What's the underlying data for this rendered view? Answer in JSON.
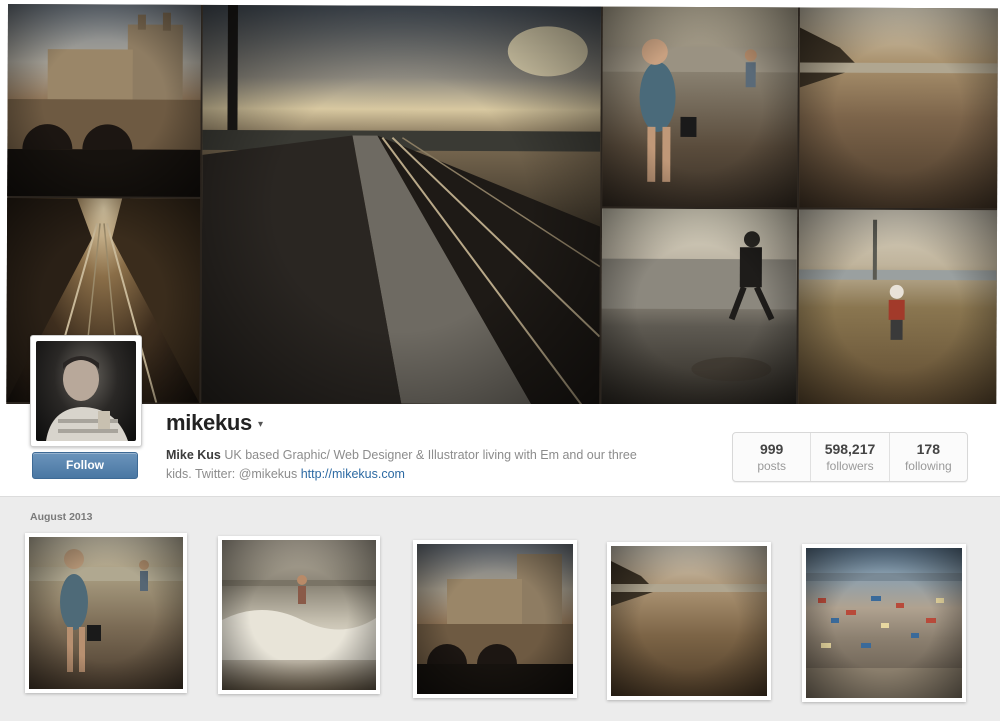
{
  "profile": {
    "username": "mikekus",
    "display_name": "Mike Kus",
    "bio_line1": "UK based Graphic/ Web Designer & Illustrator living with Em and our three",
    "bio_line2_prefix": "kids. Twitter: @mikekus",
    "website": "http://mikekus.com",
    "follow_label": "Follow"
  },
  "stats": [
    {
      "value": "999",
      "label": "posts"
    },
    {
      "value": "598,217",
      "label": "followers"
    },
    {
      "value": "178",
      "label": "following"
    }
  ],
  "feed": {
    "month": "August 2013"
  },
  "icons": {
    "caret": "caret-down-icon"
  },
  "colors": {
    "follow_button": "#4a77a3",
    "link": "#2d6aa3"
  }
}
